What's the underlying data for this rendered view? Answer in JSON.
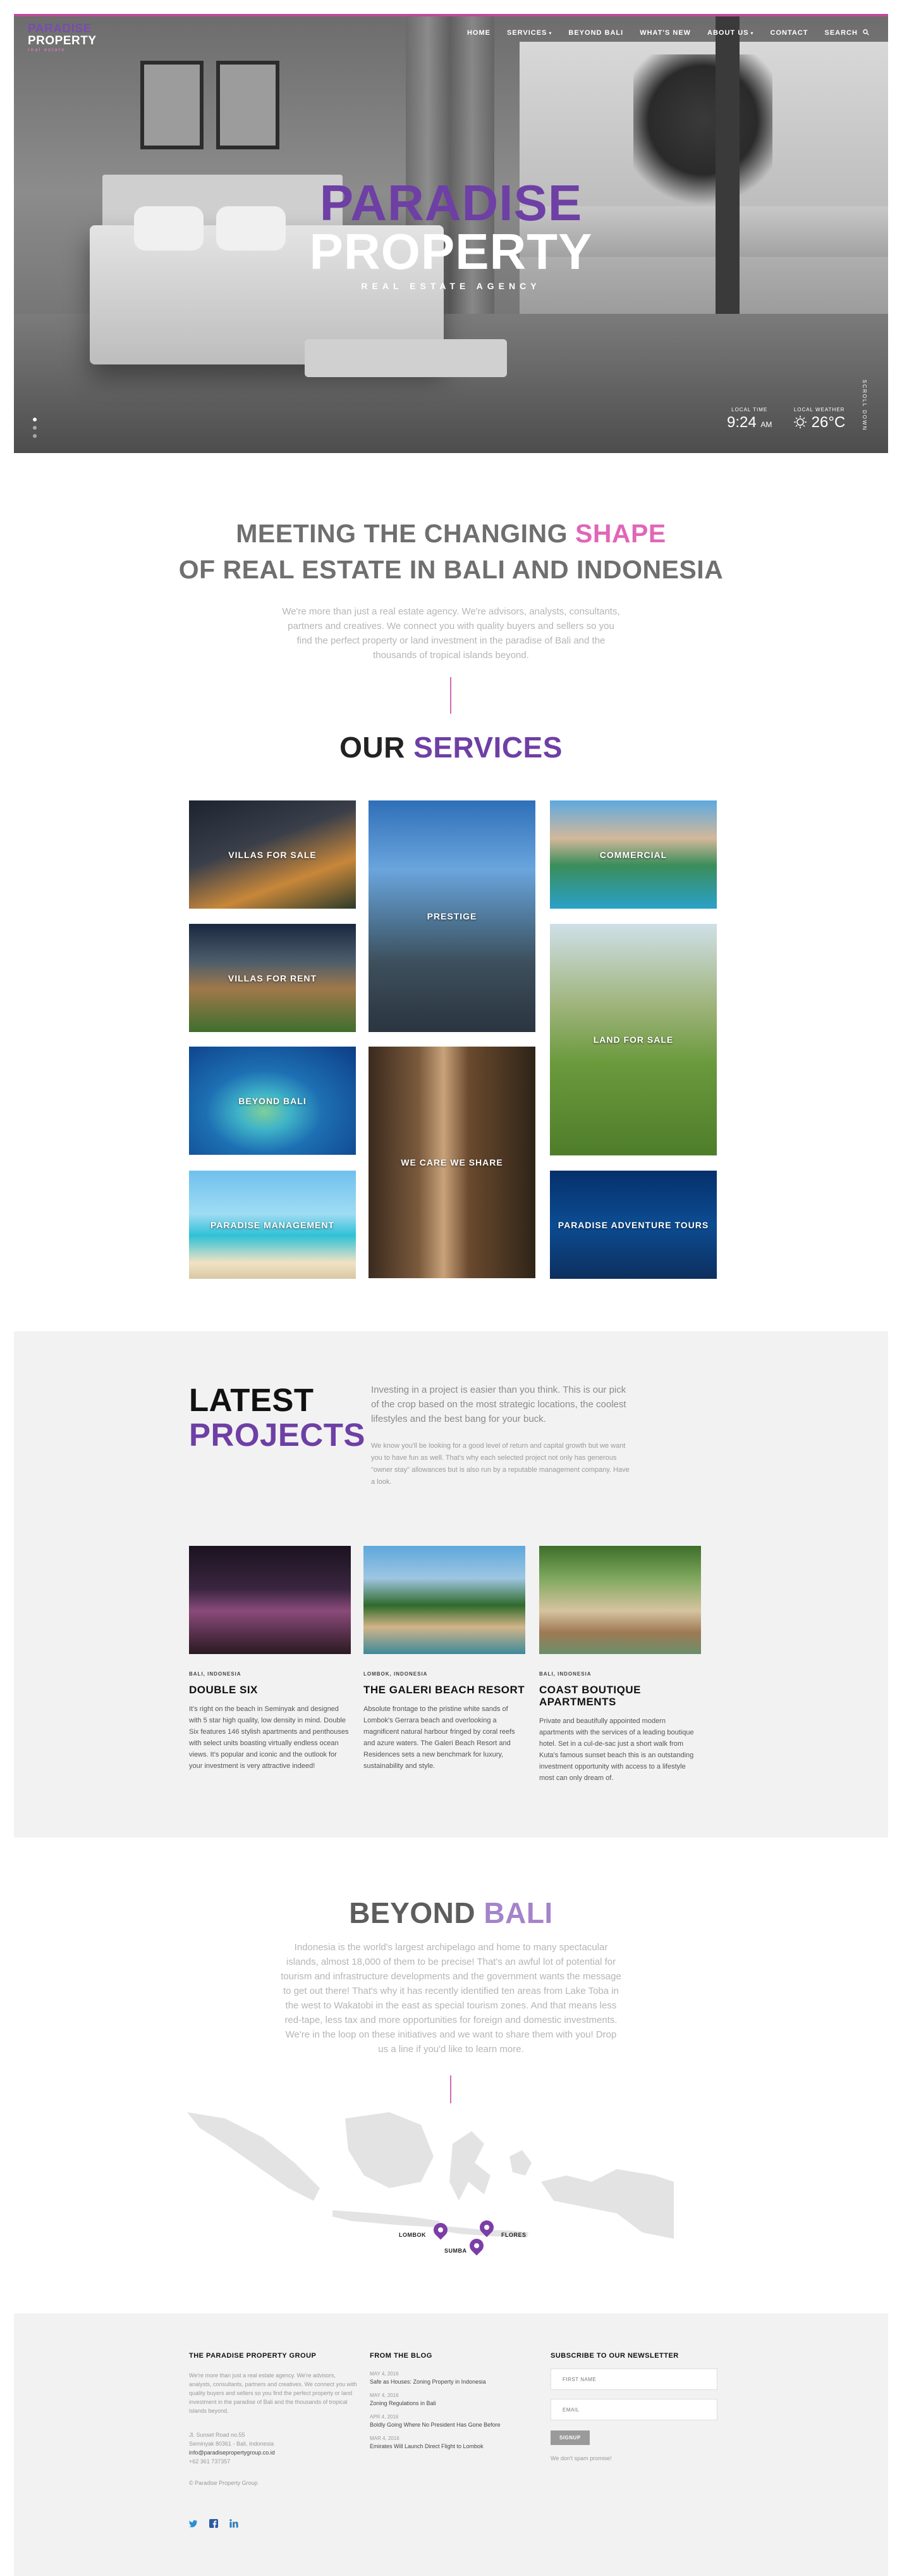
{
  "brand": {
    "logo_line1": "PARADISE",
    "logo_line2": "PROPERTY",
    "logo_line3": "real estate"
  },
  "nav": {
    "items": [
      {
        "label": "HOME",
        "dropdown": false
      },
      {
        "label": "SERVICES",
        "dropdown": true
      },
      {
        "label": "BEYOND BALI",
        "dropdown": false
      },
      {
        "label": "WHAT'S NEW",
        "dropdown": false
      },
      {
        "label": "ABOUT US",
        "dropdown": true
      },
      {
        "label": "CONTACT",
        "dropdown": false
      }
    ],
    "search_label": "SEARCH"
  },
  "hero": {
    "title_line1": "PARADISE",
    "title_line2": "PROPERTY",
    "tagline": "REAL ESTATE AGENCY",
    "time_label": "LOCAL TIME",
    "time_value": "9:24",
    "time_suffix": "AM",
    "weather_label": "LOCAL WEATHER",
    "weather_value": "26°C",
    "scroll_label": "SCROLL DOWN",
    "slide_count": 3,
    "active_slide": 1
  },
  "intro": {
    "heading_part1": "MEETING THE CHANGING",
    "heading_highlight": "SHAPE",
    "heading_line2": "OF REAL ESTATE IN BALI AND INDONESIA",
    "body": "We're more than just a real estate agency. We're advisors, analysts, consultants, partners and creatives. We connect you with quality buyers and sellers so you find the perfect property or land investment in the paradise of Bali and the thousands of tropical islands beyond."
  },
  "services": {
    "title_part1": "OUR",
    "title_part2": "SERVICES",
    "tiles": [
      "VILLAS FOR SALE",
      "PRESTIGE",
      "COMMERCIAL",
      "VILLAS FOR RENT",
      "LAND FOR SALE",
      "BEYOND BALI",
      "WE CARE WE SHARE",
      "PARADISE MANAGEMENT",
      "PARADISE ADVENTURE TOURS"
    ]
  },
  "projects": {
    "heading_line1": "LATEST",
    "heading_line2": "PROJECTS",
    "lead": "Investing in a project is easier than you think. This is our pick of the crop based on the most strategic locations, the coolest lifestyles and the best bang for your buck.",
    "sub": "We know you'll be looking for a good level of return and capital growth but we want you to have fun as well. That's why each selected project not only has generous \"owner stay\" allowances but is also run by a reputable management company. Have a look.",
    "items": [
      {
        "location": "BALI, INDONESIA",
        "name": "DOUBLE SIX",
        "desc": "It's right on the beach in Seminyak and designed with 5 star high quality, low density in mind. Double Six features 146 stylish apartments and penthouses with select units boasting virtually endless ocean views. It's popular and iconic and the outlook for your investment is very attractive indeed!"
      },
      {
        "location": "LOMBOK, INDONESIA",
        "name": "THE GALERI BEACH RESORT",
        "desc": "Absolute frontage to the pristine white sands of Lombok's Gerrara beach and overlooking a magnificent natural harbour fringed by coral reefs and azure waters. The Galeri Beach Resort and Residences sets a new benchmark for luxury, sustainability and style."
      },
      {
        "location": "BALI, INDONESIA",
        "name": "COAST BOUTIQUE APARTMENTS",
        "desc": "Private and beautifully appointed modern apartments with the services of a leading boutique hotel. Set in a cul-de-sac just a short walk from Kuta's famous sunset beach this is an outstanding investment opportunity with access to a lifestyle most can only dream of."
      }
    ]
  },
  "beyond": {
    "title_part1": "BEYOND",
    "title_part2": "BALI",
    "body": "Indonesia is the world's largest archipelago and home to many spectacular islands, almost 18,000 of them to be precise! That's an awful lot of potential for tourism and infrastructure developments and the government wants the message to get out there! That's why it has recently identified ten areas from Lake Toba in the west to Wakatobi in the east as special tourism zones. And that means less red-tape, less tax and more opportunities for foreign and domestic investments. We're in the loop on these initiatives and we want to share them with you! Drop us a line if you'd like to learn more.",
    "pins": [
      "LOMBOK",
      "FLORES",
      "SUMBA"
    ]
  },
  "footer": {
    "col1_title": "THE PARADISE PROPERTY GROUP",
    "col1_body": "We're more than just a real estate agency. We're advisors, analysts, consultants, partners and creatives. We connect you with quality buyers and sellers so you find the perfect property or land investment in the paradise of Bali and the thousands of tropical islands beyond.",
    "address1": "Jl. Sunset Road no.55",
    "address2": "Seminyak 80361 - Bali, Indonesia",
    "email": "info@paradisepropertygroup.co.id",
    "phone": "+62 361 737357",
    "copyright": "© Paradise Property Group",
    "col2_title": "FROM THE BLOG",
    "posts": [
      {
        "date": "MAY 4, 2016",
        "title": "Safe as Houses: Zoning Property in Indonesia"
      },
      {
        "date": "MAY 4, 2016",
        "title": "Zoning Regulations in Bali"
      },
      {
        "date": "APR 4, 2016",
        "title": "Boldly Going Where No President Has Gone Before"
      },
      {
        "date": "MAR 4, 2016",
        "title": "Emirates Will Launch Direct Flight to Lombok"
      }
    ],
    "col3_title": "SUBSCRIBE TO OUR NEWSLETTER",
    "name_placeholder": "FIRST NAME",
    "email_placeholder": "EMAIL",
    "signup_label": "SIGNUP",
    "spam_note": "We don't spam promise!"
  },
  "colors": {
    "purple": "#6e3fa5",
    "pink": "#e066b8",
    "footer_bg": "#f2f2f2"
  },
  "icons": [
    "search-icon",
    "weather-sun-icon",
    "map-pin-icon",
    "twitter-icon",
    "facebook-icon",
    "linkedin-icon"
  ]
}
